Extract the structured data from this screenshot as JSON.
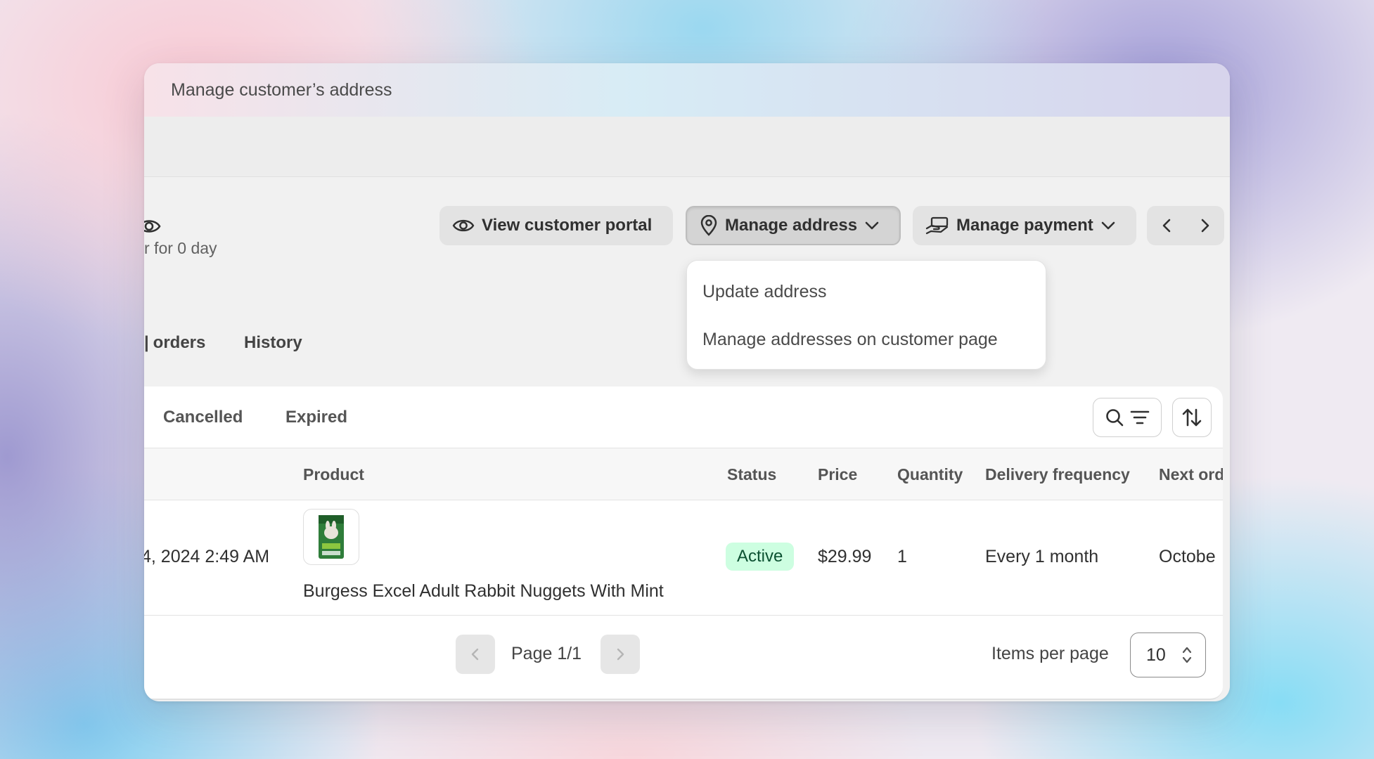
{
  "window": {
    "title": "Manage customer’s address"
  },
  "header": {
    "duration_text": "r for 0 day"
  },
  "toolbar": {
    "view_portal_label": "View customer portal",
    "manage_address_label": "Manage address",
    "manage_payment_label": "Manage payment"
  },
  "dropdown": {
    "items": [
      {
        "label": "Update address"
      },
      {
        "label": "Manage addresses on customer page"
      }
    ]
  },
  "page_tabs": {
    "orders_label": "orders",
    "history_label": "History"
  },
  "status_tabs": [
    {
      "label": "Cancelled"
    },
    {
      "label": "Expired"
    }
  ],
  "table": {
    "columns": [
      "Product",
      "Status",
      "Price",
      "Quantity",
      "Delivery frequency",
      "Next ord"
    ],
    "rows": [
      {
        "created": "4, 2024 2:49 AM",
        "product": "Burgess Excel Adult Rabbit Nuggets With Mint",
        "status": "Active",
        "price": "$29.99",
        "quantity": "1",
        "frequency": "Every 1 month",
        "next_order": "Octobe"
      }
    ]
  },
  "pagination": {
    "page_label": "Page 1/1",
    "items_per_page_label": "Items per page",
    "items_per_page_value": "10"
  },
  "colors": {
    "active_badge_bg": "#cdfee1",
    "active_badge_text": "#0c5132"
  }
}
